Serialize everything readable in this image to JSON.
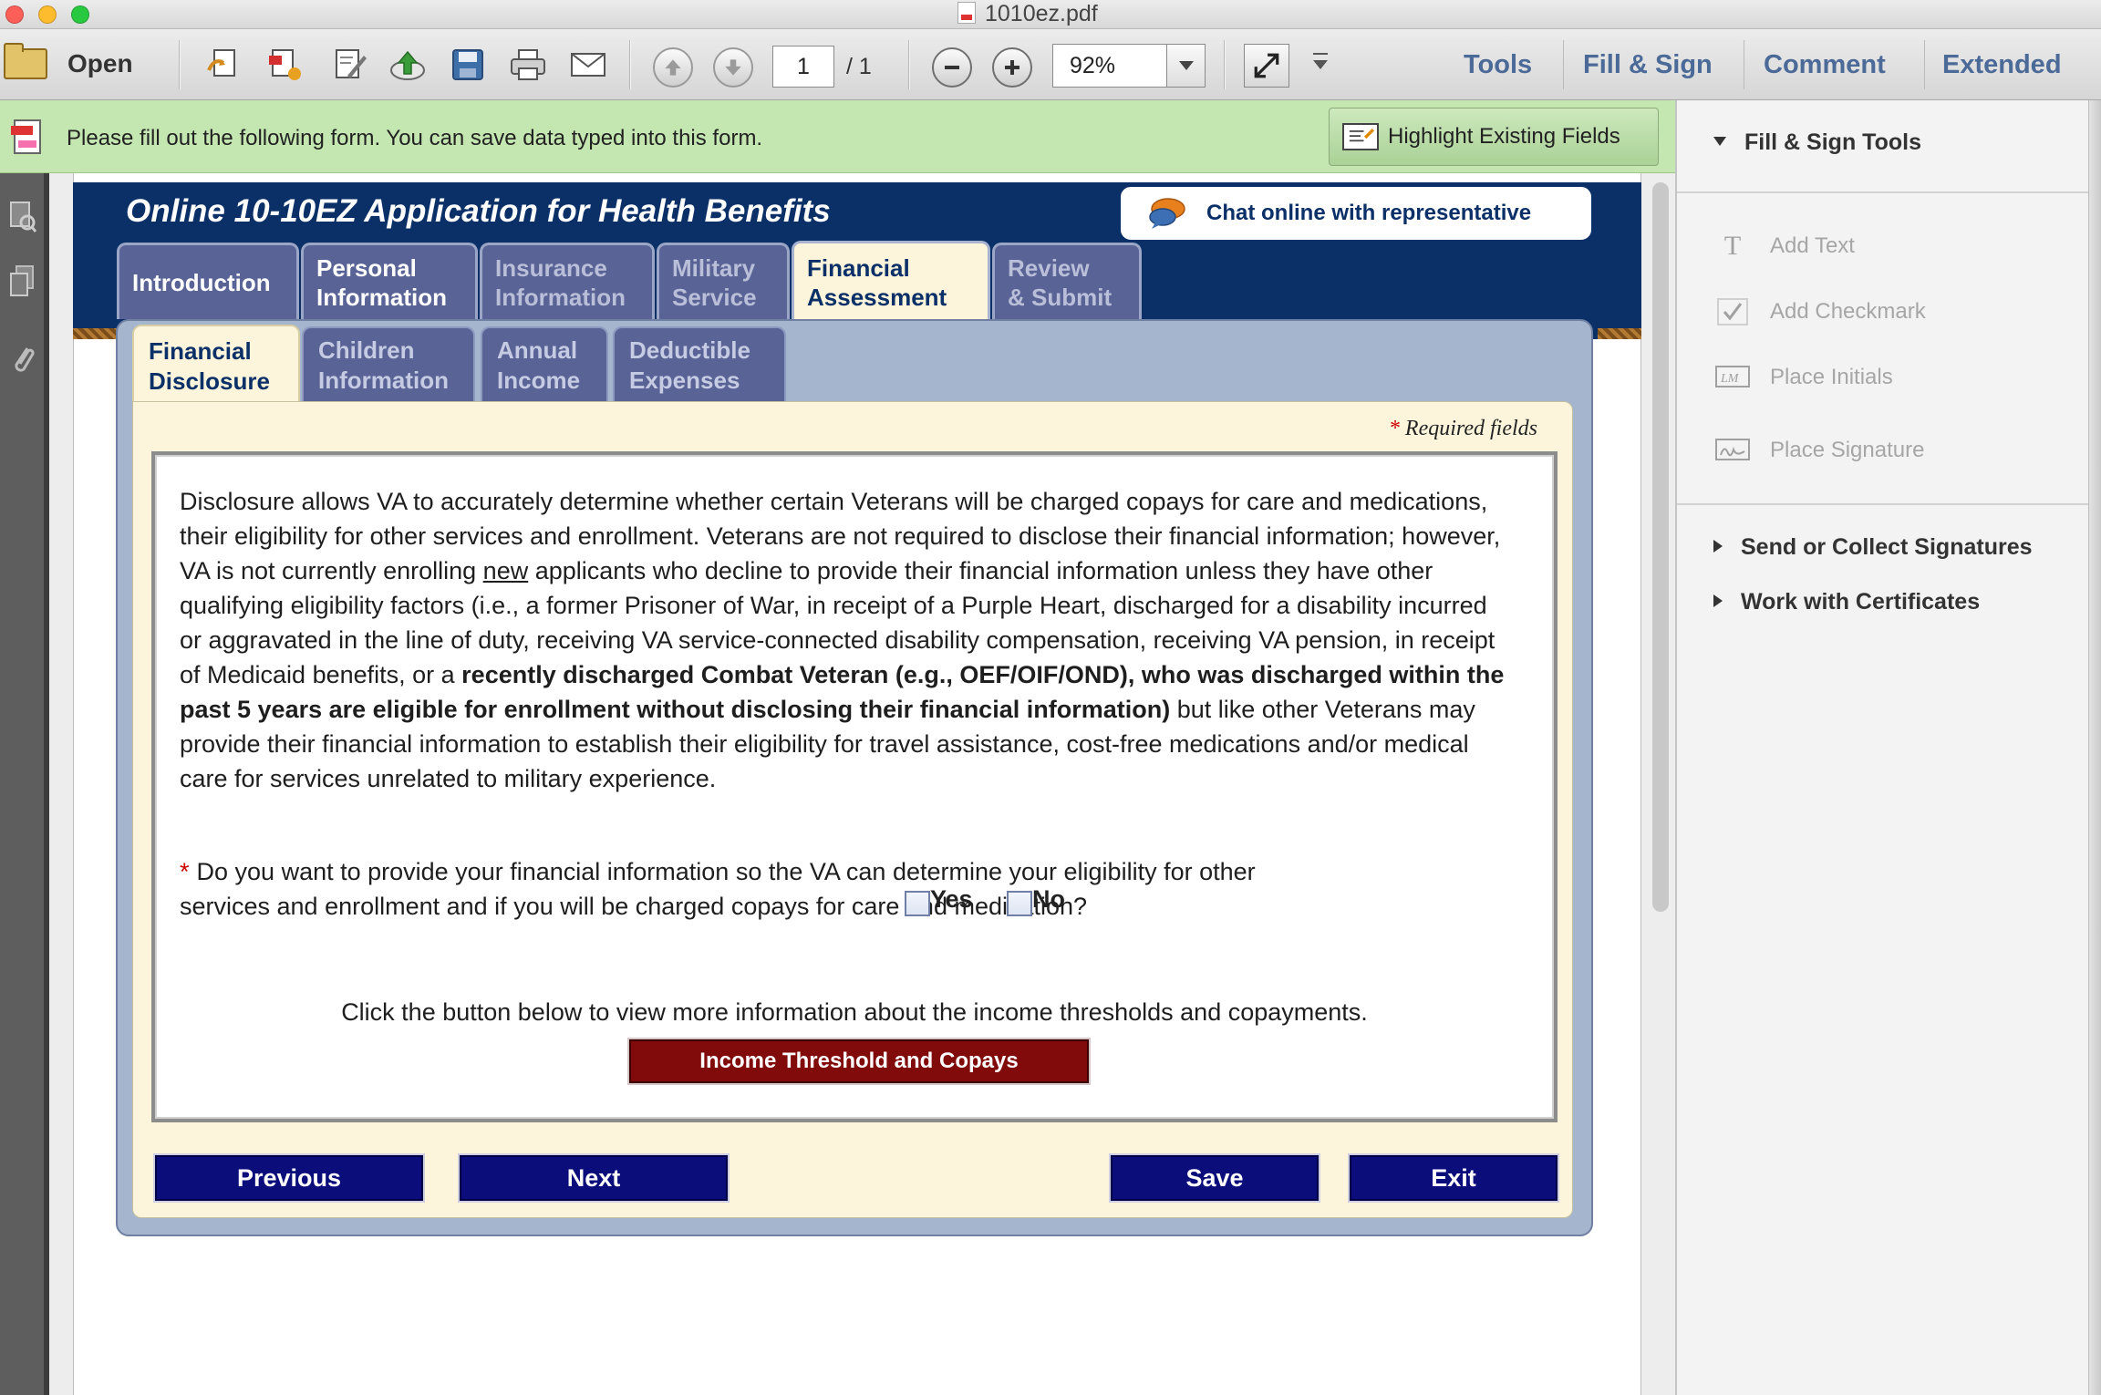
{
  "window": {
    "title": "1010ez.pdf"
  },
  "toolbar": {
    "open_label": "Open",
    "page_current": "1",
    "page_total": "/ 1",
    "zoom": "92%",
    "menus": [
      "Tools",
      "Fill & Sign",
      "Comment",
      "Extended"
    ]
  },
  "infobar": {
    "message": "Please fill out the following form. You can save data typed into this form.",
    "highlight_button": "Highlight Existing Fields"
  },
  "form": {
    "title": "Online 10-10EZ Application for Health Benefits",
    "chat_button": "Chat online with representative",
    "main_tabs": [
      {
        "line1": "Introduction",
        "line2": ""
      },
      {
        "line1": "Personal",
        "line2": "Information"
      },
      {
        "line1": "Insurance",
        "line2": "Information"
      },
      {
        "line1": "Military",
        "line2": "Service"
      },
      {
        "line1": "Financial",
        "line2": "Assessment"
      },
      {
        "line1": "Review",
        "line2": "& Submit"
      }
    ],
    "sub_tabs": [
      {
        "line1": "Financial",
        "line2": "Disclosure"
      },
      {
        "line1": "Children",
        "line2": "Information"
      },
      {
        "line1": "Annual",
        "line2": "Income"
      },
      {
        "line1": "Deductible",
        "line2": "Expenses"
      }
    ],
    "required_note": "Required fields",
    "required_star": "*",
    "paragraph": {
      "part1": "Disclosure allows VA to accurately determine whether certain Veterans will be charged copays for care and medications, their eligibility for other services and enrollment. Veterans are not required to disclose their financial information; however, VA is not currently enrolling ",
      "underlined": "new",
      "part2": " applicants who decline to provide their financial information unless they have other qualifying eligibility factors (i.e., a former Prisoner of War, in receipt of a Purple Heart, discharged for a disability incurred or aggravated in the line of duty, receiving VA service-connected disability compensation, receiving VA pension, in receipt of Medicaid benefits, or a ",
      "bold": "recently discharged Combat Veteran (e.g., OEF/OIF/OND), who was discharged within the past 5 years are eligible for enrollment without disclosing their financial information)",
      "part3": " but like other Veterans may provide their financial information to establish their eligibility for travel assistance, cost-free medications and/or medical care for services unrelated to military experience."
    },
    "question": "Do you want to provide your financial information so the VA can determine your eligibility for other services and enrollment and if you will be charged copays for care and medication?",
    "yes_label": "Yes",
    "no_label": "No",
    "info_line": "Click the button below to view more information about the income thresholds and copayments.",
    "income_button": "Income Threshold and Copays",
    "nav": {
      "previous": "Previous",
      "next": "Next",
      "save": "Save",
      "exit": "Exit"
    }
  },
  "right_panel": {
    "section_title": "Fill & Sign Tools",
    "tools": [
      {
        "icon": "text-icon",
        "label": "Add Text"
      },
      {
        "icon": "checkmark-icon",
        "label": "Add Checkmark"
      },
      {
        "icon": "initials-icon",
        "label": "Place Initials"
      },
      {
        "icon": "signature-icon",
        "label": "Place Signature"
      }
    ],
    "collapsed_sections": [
      "Send or Collect Signatures",
      "Work with Certificates"
    ]
  },
  "colors": {
    "form_navy": "#0b3068",
    "tab_purple": "#5a6396",
    "cream": "#fcf5dc",
    "button_navy": "#0a0d7a",
    "button_red": "#810a0a",
    "infobar_green": "#c4e6b1",
    "menu_blue": "#4b6a98"
  }
}
